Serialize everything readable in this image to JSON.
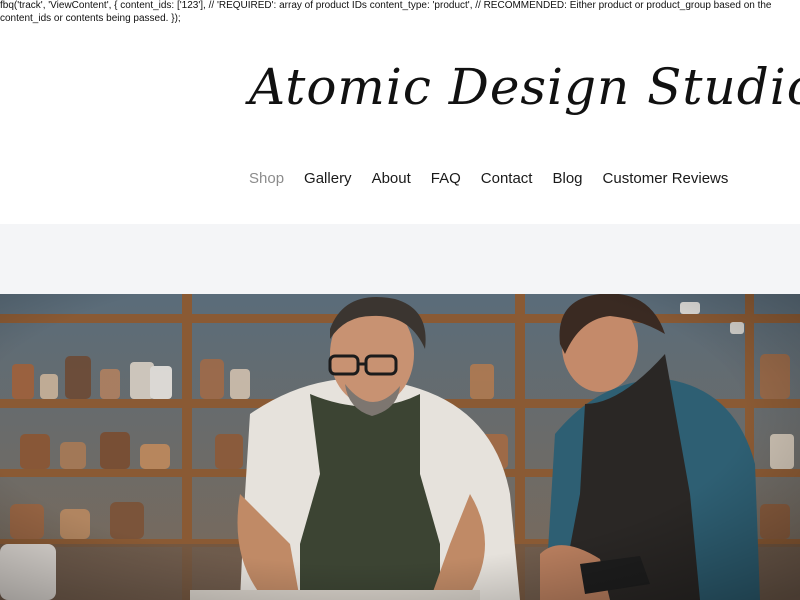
{
  "script_text": "fbq('track', 'ViewContent', { content_ids: ['123'], // 'REQUIRED': array of product IDs content_type: 'product', // RECOMMENDED: Either product or product_group based on the content_ids or contents being passed. });",
  "site": {
    "title": "Atomic Design Studio"
  },
  "nav": {
    "items": [
      {
        "label": "Shop",
        "active": true
      },
      {
        "label": "Gallery"
      },
      {
        "label": "About"
      },
      {
        "label": "FAQ"
      },
      {
        "label": "Contact"
      },
      {
        "label": "Blog"
      },
      {
        "label": "Customer Reviews"
      }
    ]
  },
  "colors": {
    "active_nav": "#8c8c8c",
    "text": "#1a1a1a",
    "band": "#f4f5f7"
  }
}
